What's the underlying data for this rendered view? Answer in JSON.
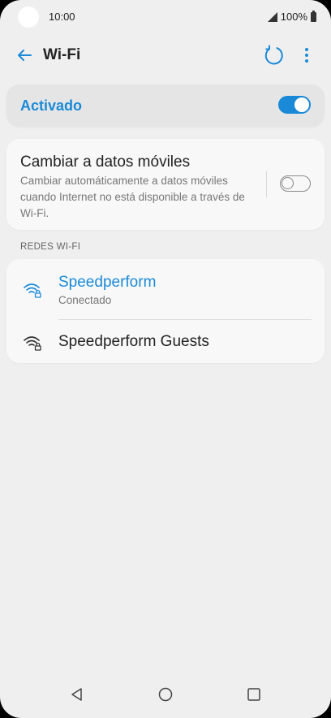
{
  "status_bar": {
    "time": "10:00",
    "battery": "100%"
  },
  "app_bar": {
    "title": "Wi-Fi"
  },
  "master_toggle": {
    "label": "Activado",
    "state": "on"
  },
  "mobile_data_switch": {
    "title": "Cambiar a datos móviles",
    "description": "Cambiar automáticamente a datos móviles cuando Internet no está disponible a través de Wi-Fi.",
    "state": "off"
  },
  "networks_section": {
    "label": "REDES WI-FI",
    "networks": [
      {
        "name": "Speedperform",
        "status": "Conectado",
        "secured": true,
        "connected": true
      },
      {
        "name": "Speedperform Guests",
        "status": "",
        "secured": true,
        "connected": false
      }
    ]
  },
  "colors": {
    "accent": "#1a8ad8",
    "background": "#efefef",
    "card": "#f8f8f8"
  },
  "icons": {
    "back": "arrow-left-icon",
    "refresh": "refresh-icon",
    "more": "more-vert-icon",
    "wifi": "wifi-lock-icon",
    "nav_back": "triangle-back-icon",
    "nav_home": "circle-home-icon",
    "nav_recents": "square-recents-icon"
  }
}
